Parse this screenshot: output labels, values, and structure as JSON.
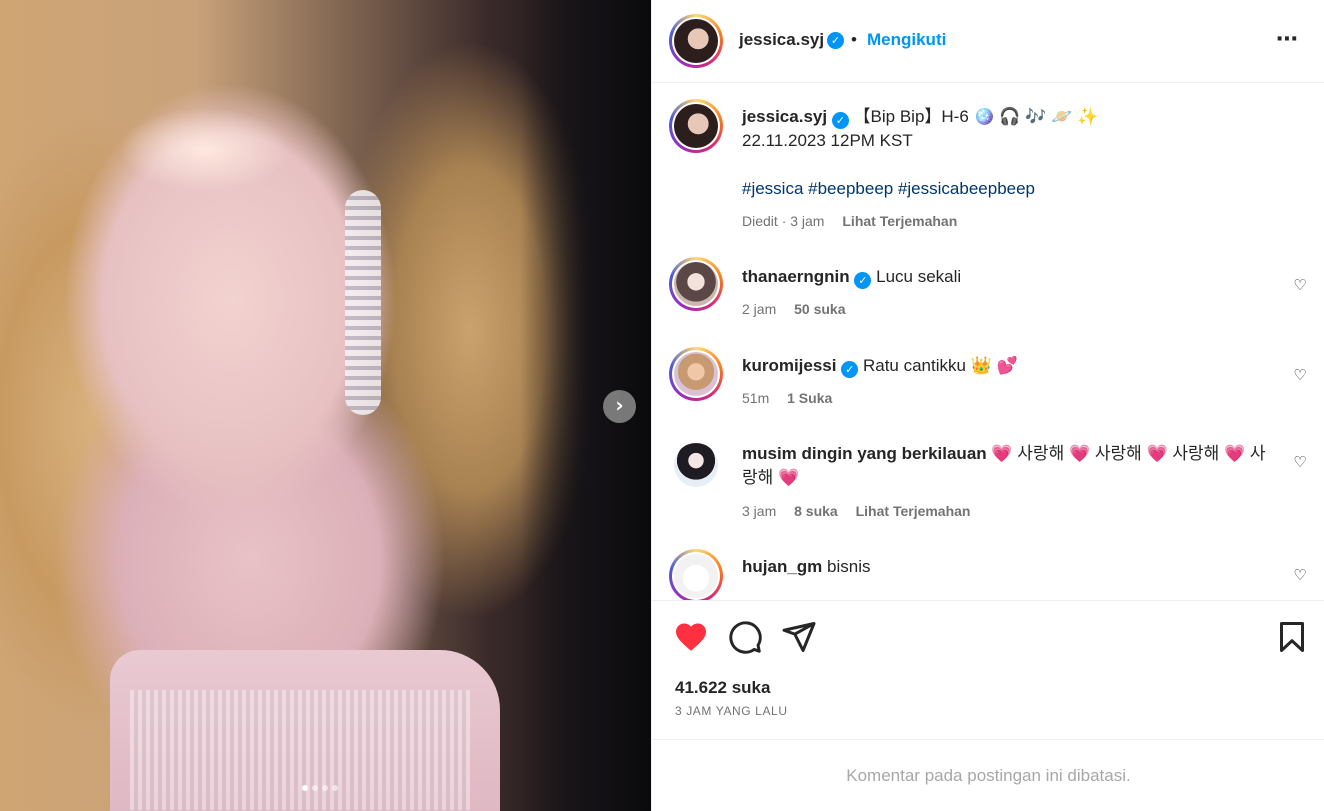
{
  "post": {
    "photo_alt": "jessica.syj",
    "carousel_total": 4,
    "carousel_active": 1
  },
  "header": {
    "username": "jessica.syj",
    "separator": "•",
    "follow_label": "Mengikuti",
    "more_label": "⋯"
  },
  "caption": {
    "username": "jessica.syj",
    "line1": "【Bip Bip】H-6 🪩 🎧 🎶 🪐 ✨",
    "line2": "22.11.2023 12PM KST",
    "hashtags": "#jessica #beepbeep #jessicabeepbeep",
    "edited": "Diedit",
    "time": "· 3 jam",
    "translate": "Lihat Terjemahan"
  },
  "comments": [
    {
      "username": "thanaerngnin",
      "verified": true,
      "text": "Lucu sekali",
      "time": "2 jam",
      "likes": "50 suka",
      "translate": ""
    },
    {
      "username": "kuromijessi",
      "verified": true,
      "text": "Ratu cantikku 👑 💕",
      "time": "51m",
      "likes": "1 Suka",
      "translate": ""
    },
    {
      "username": "musim dingin yang berkilauan",
      "verified": false,
      "text": "💗 사랑해 💗 사랑해 💗 사랑해 💗 사랑해 💗",
      "time": "3 jam",
      "likes": "8 suka",
      "translate": "Lihat Terjemahan"
    },
    {
      "username": "hujan_gm",
      "verified": false,
      "text": "bisnis",
      "time": "",
      "likes": "",
      "translate": ""
    }
  ],
  "icons": {
    "like": "heart-filled-icon",
    "comment": "comment-icon",
    "share": "send-icon",
    "save": "bookmark-icon",
    "comment_like": "heart-outline-icon",
    "next": "chevron-right-icon",
    "verified": "verified-badge-icon"
  },
  "colors": {
    "like_red": "#ff3040",
    "link_blue": "#0095f6",
    "hashtag_blue": "#00376b"
  },
  "footer": {
    "likes": "41.622 suka",
    "time_ago": "3 JAM YANG LALU",
    "comments_limited": "Komentar pada postingan ini dibatasi."
  }
}
